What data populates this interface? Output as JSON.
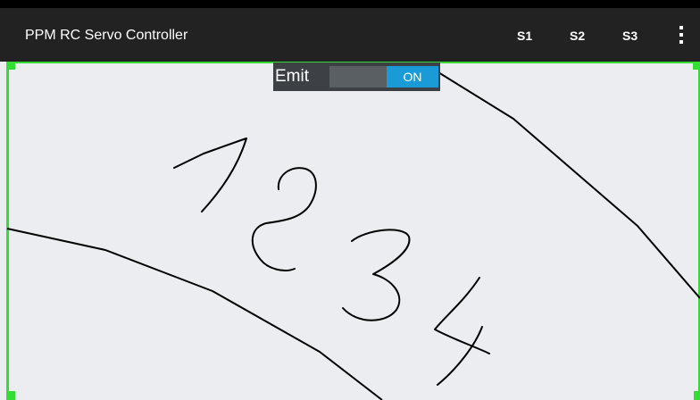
{
  "app": {
    "title": "PPM RC Servo Controller"
  },
  "actionbar": {
    "actions": [
      {
        "label": "S1"
      },
      {
        "label": "S2"
      },
      {
        "label": "S3"
      }
    ],
    "overflow_icon": "overflow-menu-icon"
  },
  "emit": {
    "label": "Emit",
    "state": "ON",
    "accent": "#1a9ad6"
  },
  "canvas": {
    "background": "#ecedf0",
    "border_color": "#33dd33",
    "handwritten_digits": "1234",
    "stroke_color": "#000000"
  }
}
